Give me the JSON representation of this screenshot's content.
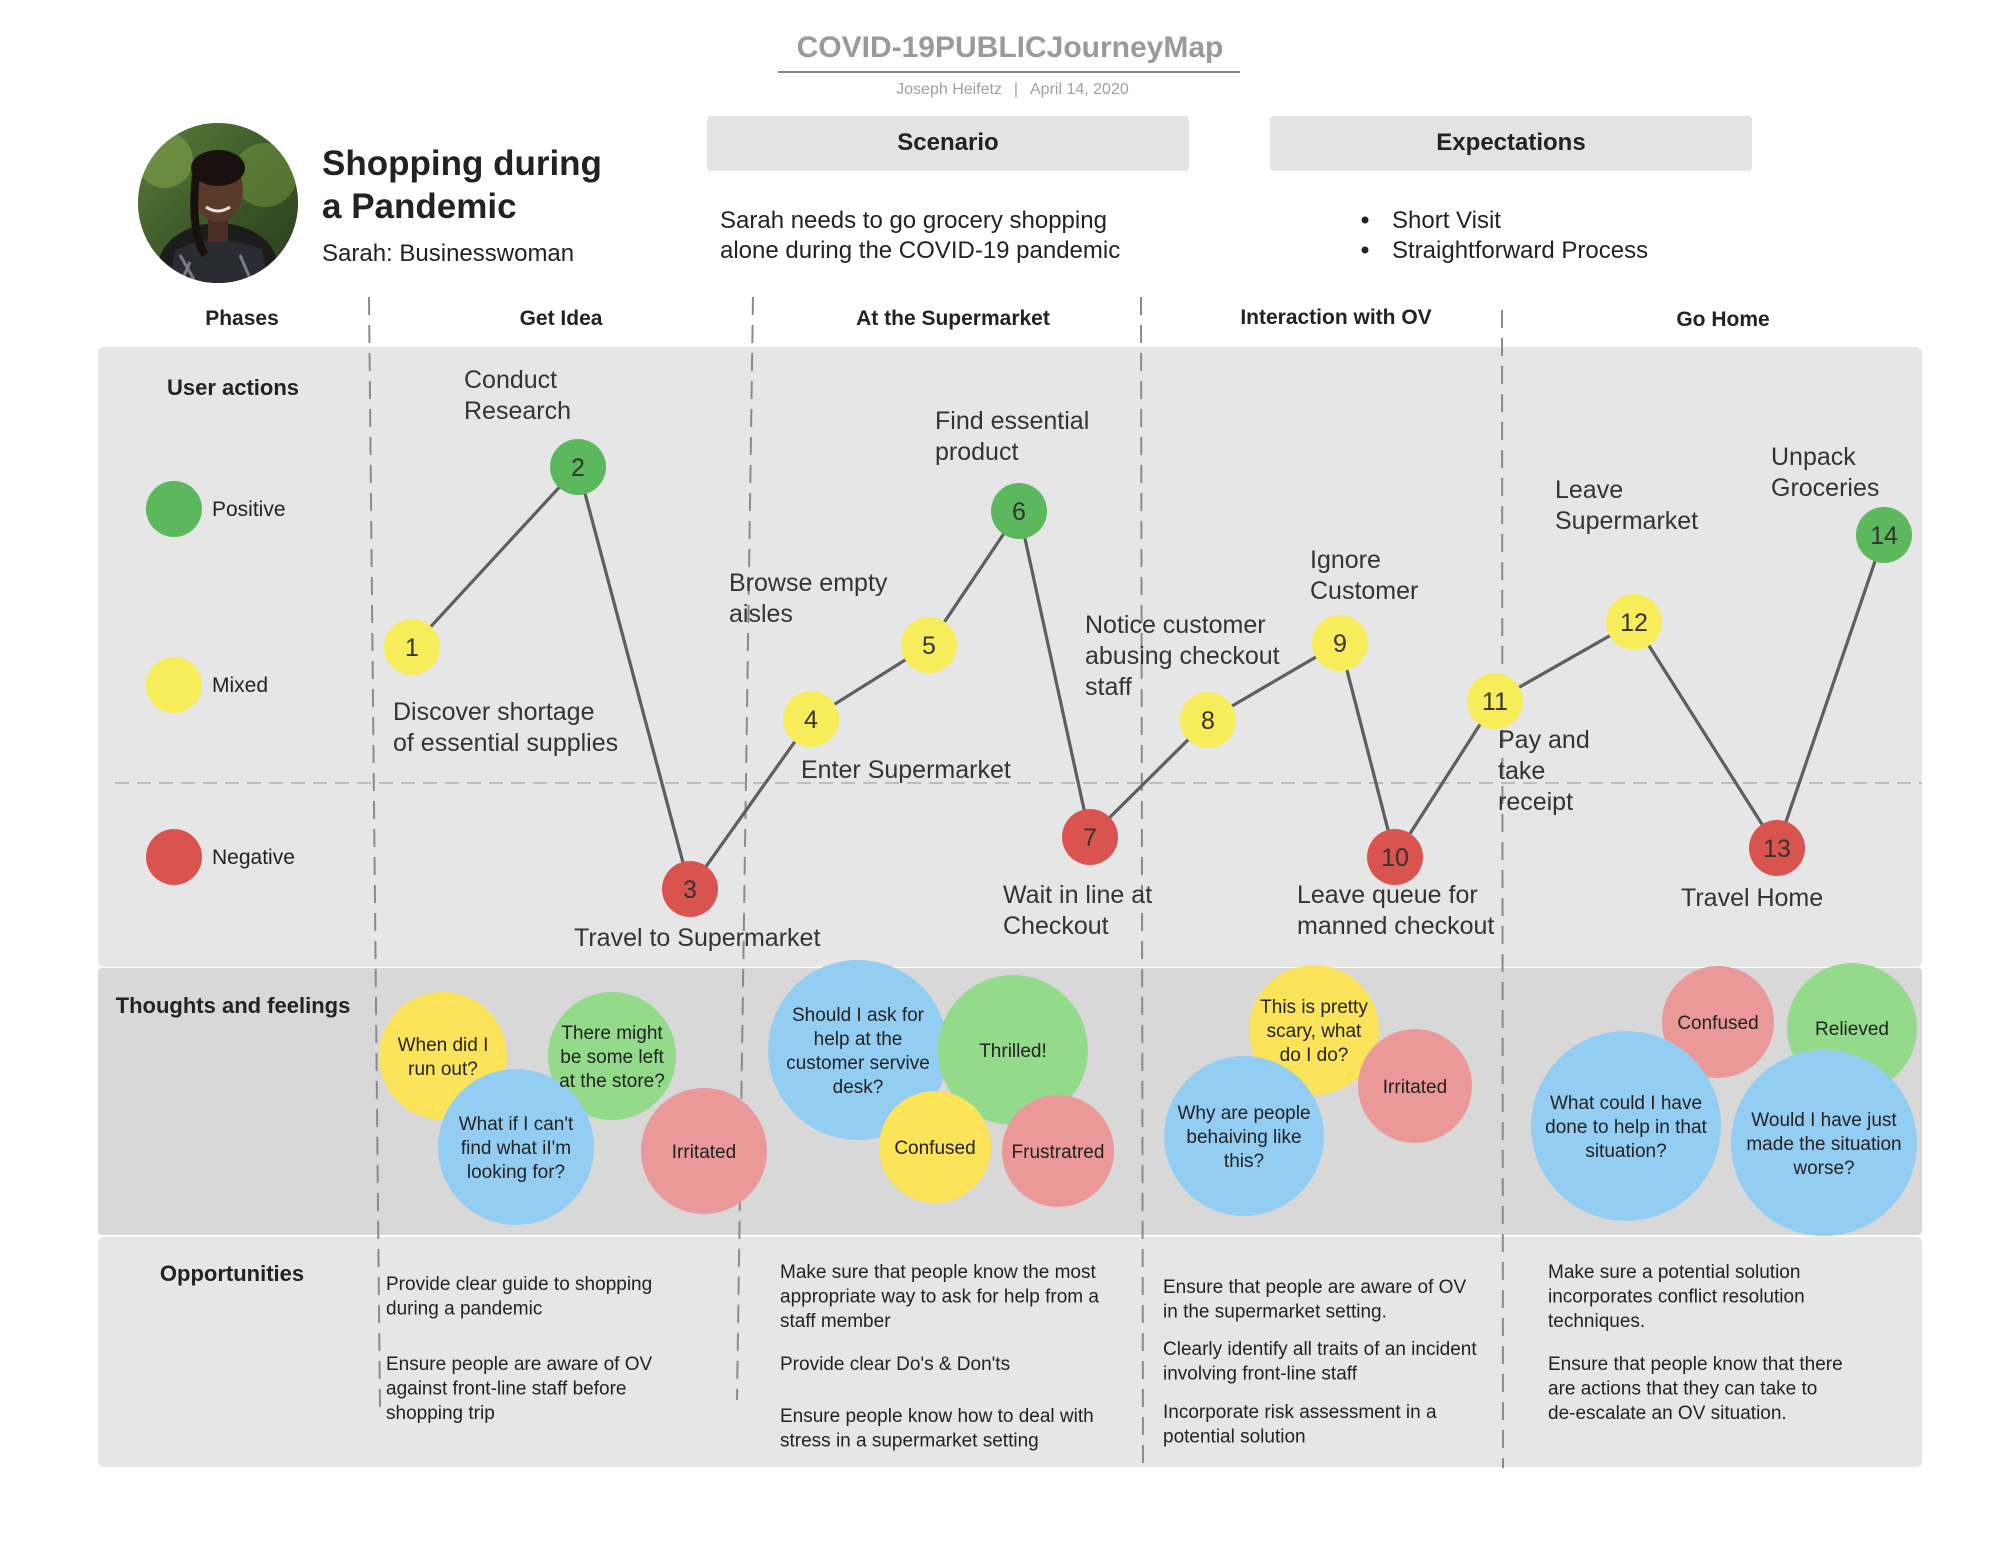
{
  "header": {
    "title": "COVID-19PUBLICJourneyMap",
    "author": "Joseph Heifetz",
    "separator": "|",
    "date": "April 14, 2020"
  },
  "persona": {
    "photo_alt": "persona-photo",
    "title_line1": "Shopping during",
    "title_line2": "a Pandemic",
    "subtitle": "Sarah: Businesswoman"
  },
  "scenario": {
    "label": "Scenario",
    "text_line1": "Sarah needs to go grocery shopping",
    "text_line2": "alone during the COVID-19 pandemic"
  },
  "expectations": {
    "label": "Expectations",
    "items": [
      "Short Visit",
      "Straightforward Process"
    ]
  },
  "phases": {
    "label": "Phases",
    "items": [
      "Get Idea",
      "At the Supermarket",
      "Interaction with OV",
      "Go Home"
    ]
  },
  "rows": {
    "user_actions": "User actions",
    "thoughts": "Thoughts and feelings",
    "opportunities": "Opportunities"
  },
  "legend": [
    {
      "label": "Positive",
      "color": "#5cb85c"
    },
    {
      "label": "Mixed",
      "color": "#f7ec5a"
    },
    {
      "label": "Negative",
      "color": "#d9534f"
    }
  ],
  "steps": [
    {
      "n": "1",
      "sentiment": "mixed",
      "lines": [
        "Discover shortage",
        "of essential supplies"
      ]
    },
    {
      "n": "2",
      "sentiment": "positive",
      "lines": [
        "Conduct",
        "Research"
      ]
    },
    {
      "n": "3",
      "sentiment": "negative",
      "lines": [
        "Travel to Supermarket"
      ]
    },
    {
      "n": "4",
      "sentiment": "mixed",
      "lines": [
        "Enter Supermarket"
      ]
    },
    {
      "n": "5",
      "sentiment": "mixed",
      "lines": [
        "Browse empty",
        "aisles"
      ]
    },
    {
      "n": "6",
      "sentiment": "positive",
      "lines": [
        "Find essential",
        "product"
      ]
    },
    {
      "n": "7",
      "sentiment": "negative",
      "lines": [
        "Wait in line at",
        "Checkout"
      ]
    },
    {
      "n": "8",
      "sentiment": "mixed",
      "lines": [
        "Notice customer",
        "abusing checkout",
        "staff"
      ]
    },
    {
      "n": "9",
      "sentiment": "mixed",
      "lines": [
        "Ignore",
        "Customer"
      ]
    },
    {
      "n": "10",
      "sentiment": "negative",
      "lines": [
        "Leave queue for",
        "manned checkout"
      ]
    },
    {
      "n": "11",
      "sentiment": "mixed",
      "lines": [
        "Pay and",
        "take",
        "receipt"
      ]
    },
    {
      "n": "12",
      "sentiment": "mixed",
      "lines": [
        "Leave",
        "Supermarket"
      ]
    },
    {
      "n": "13",
      "sentiment": "negative",
      "lines": [
        "Travel Home"
      ]
    },
    {
      "n": "14",
      "sentiment": "positive",
      "lines": [
        "Unpack",
        "Groceries"
      ]
    }
  ],
  "thoughts": [
    {
      "color": "yellow",
      "lines": [
        "When did I",
        "run out?"
      ]
    },
    {
      "color": "green",
      "lines": [
        "There might",
        "be some left",
        "at the store?"
      ]
    },
    {
      "color": "blue",
      "lines": [
        "What if I can't",
        "find what iI'm",
        "looking for?"
      ]
    },
    {
      "color": "red",
      "lines": [
        "Irritated"
      ]
    },
    {
      "color": "blue",
      "lines": [
        "Should I ask for",
        "help at the",
        "customer servive",
        "desk?"
      ]
    },
    {
      "color": "green",
      "lines": [
        "Thrilled!"
      ]
    },
    {
      "color": "yellow",
      "lines": [
        "Confused"
      ]
    },
    {
      "color": "red",
      "lines": [
        "Frustratred"
      ]
    },
    {
      "color": "yellow",
      "lines": [
        "This is pretty",
        "scary, what",
        "do I do?"
      ]
    },
    {
      "color": "red",
      "lines": [
        "Irritated"
      ]
    },
    {
      "color": "blue",
      "lines": [
        "Why are people",
        "behaiving like",
        "this?"
      ]
    },
    {
      "color": "red",
      "lines": [
        "Confused"
      ]
    },
    {
      "color": "green",
      "lines": [
        "Relieved"
      ]
    },
    {
      "color": "blue",
      "lines": [
        "What could I have",
        "done to help in that",
        "situation?"
      ]
    },
    {
      "color": "blue",
      "lines": [
        "Would I have just",
        "made the situation",
        "worse?"
      ]
    }
  ],
  "opportunities": [
    {
      "phase": "Get Idea",
      "items": [
        [
          "Provide clear guide to shopping",
          "during a pandemic"
        ],
        [
          "Ensure people are aware of OV",
          "against front-line staff before",
          "shopping trip"
        ]
      ]
    },
    {
      "phase": "At the Supermarket",
      "items": [
        [
          "Make sure that people know the most",
          "appropriate way to ask for help from a",
          "staff member"
        ],
        [
          "Provide clear Do's & Don'ts"
        ],
        [
          "Ensure people know how to deal with",
          "stress in a supermarket setting"
        ]
      ]
    },
    {
      "phase": "Interaction with OV",
      "items": [
        [
          "Ensure that people are aware of OV",
          "in the supermarket setting."
        ],
        [
          "Clearly identify all traits of an incident",
          "involving front-line staff"
        ],
        [
          "Incorporate risk assessment in a",
          "potential solution"
        ]
      ]
    },
    {
      "phase": "Go Home",
      "items": [
        [
          "Make sure a potential solution",
          "incorporates conflict resolution",
          "techniques."
        ],
        [
          "Ensure that people know that there",
          "are actions that they can take to",
          "de-escalate an OV situation."
        ]
      ]
    }
  ],
  "colors": {
    "positive": "#5cb85c",
    "mixed": "#f7ec5a",
    "negative": "#d9534f",
    "bubble_yellow": "#fbe35a",
    "bubble_green": "#93da8b",
    "bubble_blue": "#94cdf2",
    "bubble_red": "#eb9898",
    "panel": "#e6e6e6",
    "panel_dark": "#d9d9d9"
  }
}
